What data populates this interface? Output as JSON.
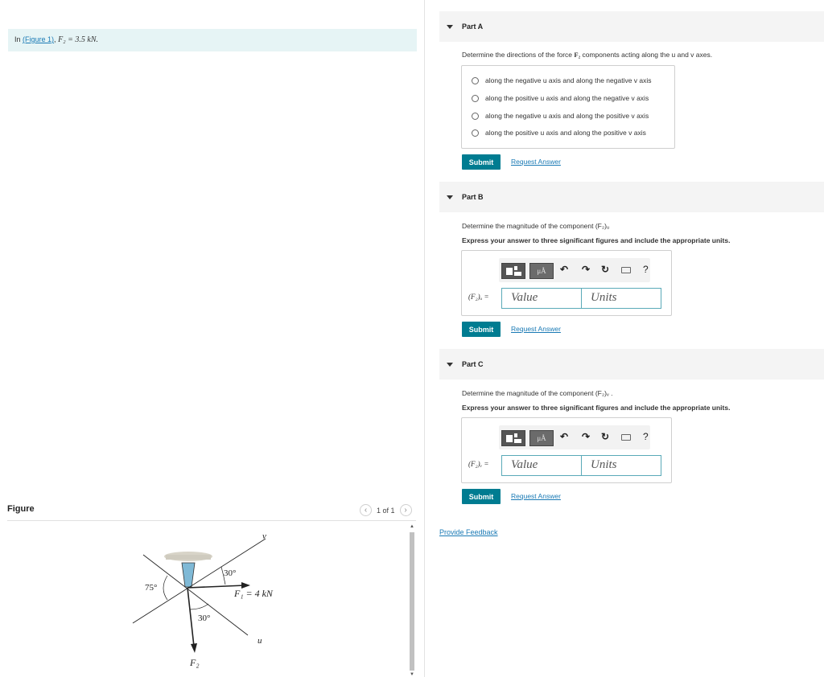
{
  "intro": {
    "prefix": "In",
    "figure_link": "(Figure 1)",
    "suffix": ", ",
    "given": "F₂ = 3.5 kN."
  },
  "figure": {
    "title": "Figure",
    "pager": "1 of 1",
    "labels": {
      "v": "v",
      "u": "u",
      "angle_75": "75°",
      "angle_30_top": "30°",
      "angle_30_bottom": "30°",
      "f1": "F₁ = 4 kN",
      "f2": "F₂"
    }
  },
  "partA": {
    "header": "Part A",
    "question_pre": "Determine the directions of the force ",
    "question_force": "F₂",
    "question_post": " components acting along the u and v axes.",
    "choices": [
      "along the negative u axis and along the negative v axis",
      "along the positive u axis and along the negative v axis",
      "along the negative u axis and along the positive v axis",
      "along the positive u axis and along the positive v axis"
    ],
    "submit": "Submit",
    "request": "Request Answer"
  },
  "partB": {
    "header": "Part B",
    "question": "Determine the magnitude of the component (F₂)ᵤ",
    "instructions": "Express your answer to three significant figures and include the appropriate units.",
    "var_label": "(F₂)ᵤ =",
    "value_placeholder": "Value",
    "units_placeholder": "Units",
    "submit": "Submit",
    "request": "Request Answer"
  },
  "partC": {
    "header": "Part C",
    "question": "Determine the magnitude of the component (F₂)ᵥ .",
    "instructions": "Express your answer to three significant figures and include the appropriate units.",
    "var_label": "(F₂)ᵥ =",
    "value_placeholder": "Value",
    "units_placeholder": "Units",
    "submit": "Submit",
    "request": "Request Answer"
  },
  "toolbar": {
    "mu_label": "μÅ",
    "help": "?"
  },
  "feedback": "Provide Feedback",
  "colors": {
    "accent": "#007c91",
    "link": "#1a7ab5",
    "intro_bg": "#e6f4f5"
  }
}
